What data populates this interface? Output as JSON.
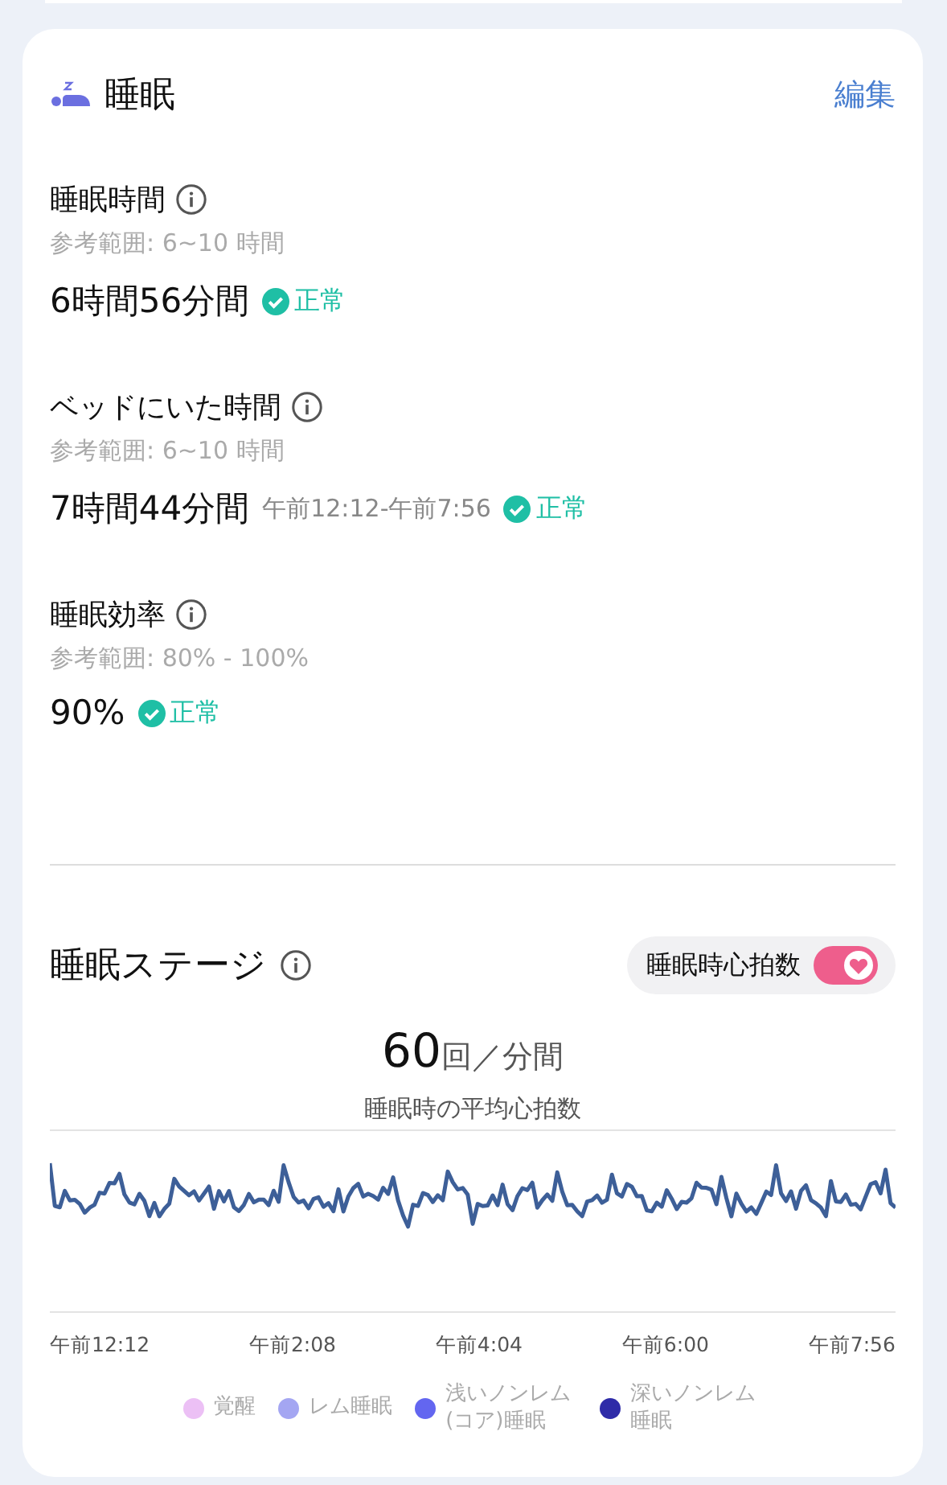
{
  "card": {
    "title": "睡眠",
    "edit_link": "編集"
  },
  "metrics": [
    {
      "label": "睡眠時間",
      "range": "参考範囲: 6~10 時間",
      "value": "6時間56分間",
      "status": "正常"
    },
    {
      "label": "ベッドにいた時間",
      "range": "参考範囲: 6~10 時間",
      "value": "7時間44分間",
      "time_range": "午前12:12-午前7:56",
      "status": "正常"
    },
    {
      "label": "睡眠効率",
      "range": "参考範囲: 80% - 100%",
      "value": "90%",
      "status": "正常"
    }
  ],
  "stages": {
    "title": "睡眠ステージ",
    "toggle": {
      "label": "睡眠時心拍数",
      "on": true
    },
    "avg_value": "60",
    "avg_unit": "回／分間",
    "avg_caption": "睡眠時の平均心拍数",
    "x_labels": [
      "午前12:12",
      "午前2:08",
      "午前4:04",
      "午前6:00",
      "午前7:56"
    ],
    "legend": [
      {
        "label": "覚醒",
        "color": "#ecc0f5"
      },
      {
        "label": "レム睡眠",
        "color": "#a4a6f2"
      },
      {
        "label": "浅いノンレム(コア)睡眠",
        "color": "#6366f0"
      },
      {
        "label": "深いノンレム睡眠",
        "color": "#2e2ba8"
      }
    ]
  }
}
